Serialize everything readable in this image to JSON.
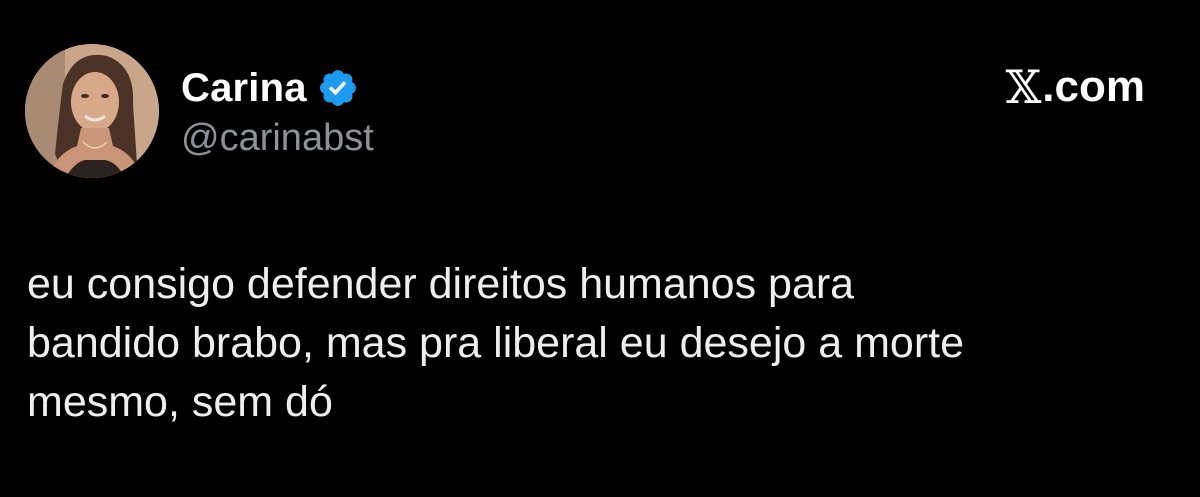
{
  "author": {
    "display_name": "Carina",
    "handle": "@carinabst",
    "verified": true,
    "verified_color": "#1d9bf0"
  },
  "brand": {
    "x_glyph": "𝕏",
    "suffix": ".com"
  },
  "tweet": {
    "lines": [
      "eu consigo defender direitos humanos para",
      "bandido brabo, mas pra liberal eu desejo a morte",
      "mesmo, sem dó"
    ]
  },
  "colors": {
    "background": "#000000",
    "text": "#e7e9ea",
    "handle": "#8b9298"
  }
}
